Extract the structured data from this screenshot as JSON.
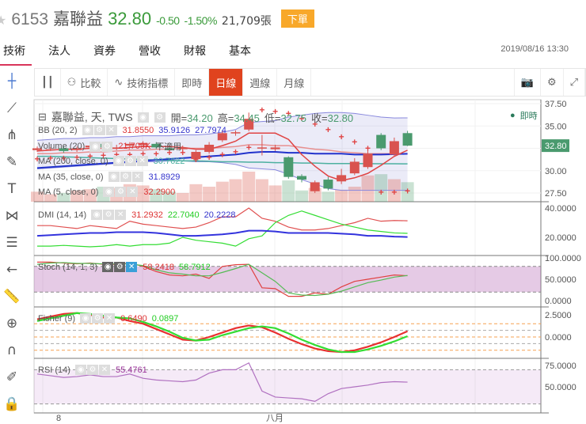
{
  "header": {
    "code": "6153",
    "name": "嘉聯益",
    "price": "32.80",
    "change": "-0.50",
    "change_pct": "-1.50%",
    "volume": "21,709張",
    "order_button": "下單"
  },
  "tabs": [
    {
      "label": "技術"
    },
    {
      "label": "法人"
    },
    {
      "label": "資券"
    },
    {
      "label": "營收"
    },
    {
      "label": "財報"
    },
    {
      "label": "基本"
    }
  ],
  "timestamp": "2019/08/16 13:30",
  "toolbar": {
    "compare": "比較",
    "indicators": "技術指標",
    "intraday": "即時",
    "daily": "日線",
    "weekly": "週線",
    "monthly": "月線"
  },
  "legend": {
    "title": "嘉聯益, 天, TWS",
    "open_label": "開=",
    "open": "34.20",
    "high_label": "高=",
    "high": "34.45",
    "low_label": "低=",
    "low": "32.75",
    "close_label": "收=",
    "close": "32.80",
    "bb": "BB (20, 2)",
    "bb_v": [
      "31.8550",
      "35.9126",
      "27.7974"
    ],
    "volume": "Volume (20)",
    "volume_v": [
      "21,709K",
      "不適用"
    ],
    "ma200": "MA (200, close, 0)",
    "ma200_v": "30.7622",
    "ma35": "MA (35, close, 0)",
    "ma35_v": "31.8929",
    "ma5": "MA (5, close, 0)",
    "ma5_v": "32.2900",
    "dmi": "DMI (14, 14)",
    "dmi_v": [
      "31.2932",
      "22.7040",
      "20.2228"
    ],
    "stoch": "Stoch (14, 1, 3)",
    "stoch_v": [
      "58.2418",
      "58.7912"
    ],
    "fisher": "Fisher (9)",
    "fisher_v": [
      "0.6490",
      "0.0897"
    ],
    "rsi": "RSI (14)",
    "rsi_v": "55.4761",
    "live": "即時"
  },
  "axis": {
    "price_ticks": [
      "37.50",
      "35.00",
      "30.00",
      "27.50"
    ],
    "last_price": "32.80",
    "dmi_ticks": [
      "40.0000",
      "20.0000"
    ],
    "stoch_ticks": [
      "100.0000",
      "50.0000",
      "0.0000"
    ],
    "fisher_ticks": [
      "2.5000",
      "0.0000"
    ],
    "rsi_ticks": [
      "75.0000",
      "50.0000"
    ],
    "x_ticks": [
      "8",
      "八月"
    ]
  },
  "colors": {
    "up": "#d9534f",
    "down": "#4a9a6e",
    "accent": "#e0431e"
  },
  "chart_data": {
    "type": "candlestick",
    "open": [
      32.3,
      32.4,
      32.5,
      32.3,
      32.6,
      33.0,
      32.5,
      32.8,
      32.9,
      33.0,
      32.5,
      32.4,
      31.3,
      32.1,
      33.4,
      34.2,
      34.6,
      32.5,
      32.4,
      31.5,
      29.4,
      27.7,
      29.0,
      28.8,
      29.7,
      30.4,
      34.0,
      31.8,
      34.2
    ],
    "close": [
      32.5,
      32.4,
      32.2,
      32.5,
      32.8,
      32.6,
      32.6,
      33.0,
      33.1,
      32.6,
      32.3,
      32.6,
      32.1,
      32.9,
      34.2,
      34.3,
      35.8,
      32.6,
      32.6,
      29.3,
      29.0,
      28.7,
      28.0,
      29.5,
      31.0,
      31.9,
      32.5,
      33.3,
      32.8
    ],
    "high": [
      32.7,
      32.6,
      32.7,
      32.7,
      33.0,
      33.2,
      32.9,
      33.2,
      33.3,
      33.2,
      32.7,
      32.8,
      32.3,
      33.2,
      34.5,
      34.5,
      36.5,
      34.0,
      32.9,
      31.6,
      29.6,
      28.9,
      29.3,
      30.2,
      31.4,
      32.3,
      34.2,
      33.7,
      34.45
    ],
    "low": [
      32.1,
      32.2,
      32.0,
      32.1,
      32.4,
      32.4,
      32.3,
      32.6,
      32.7,
      32.4,
      32.0,
      32.2,
      31.1,
      31.9,
      33.2,
      33.9,
      34.4,
      31.7,
      32.2,
      29.1,
      28.7,
      27.5,
      27.8,
      28.5,
      29.5,
      30.2,
      32.3,
      31.6,
      32.75
    ],
    "volume": [
      4000,
      3000,
      3500,
      4500,
      5000,
      6000,
      5500,
      7000,
      6500,
      5000,
      4000,
      3500,
      7000,
      6000,
      8000,
      9000,
      12000,
      9000,
      6500,
      8500,
      4500,
      5500,
      4000,
      4800,
      6000,
      10500,
      11000,
      9000,
      7800
    ],
    "bb_upper": [
      33.4,
      33.5,
      33.6,
      33.6,
      33.7,
      33.7,
      33.8,
      33.8,
      33.9,
      33.9,
      33.9,
      34.0,
      34.0,
      34.1,
      34.3,
      34.6,
      35.4,
      35.5,
      35.6,
      36.0,
      36.2,
      36.4,
      36.5,
      36.5,
      36.4,
      36.2,
      36.0,
      35.9,
      35.91
    ],
    "bb_mid": [
      31.9,
      31.9,
      32.0,
      32.0,
      32.1,
      32.1,
      32.2,
      32.3,
      32.3,
      32.4,
      32.4,
      32.5,
      32.5,
      32.5,
      32.6,
      32.7,
      32.9,
      32.9,
      32.8,
      32.8,
      32.6,
      32.4,
      32.3,
      32.1,
      32.0,
      31.9,
      31.9,
      31.9,
      31.86
    ],
    "bb_lower": [
      30.2,
      30.3,
      30.4,
      30.5,
      30.6,
      30.7,
      30.8,
      30.9,
      31.0,
      31.0,
      31.1,
      31.1,
      31.0,
      31.0,
      30.9,
      30.7,
      30.3,
      30.2,
      30.1,
      29.6,
      29.0,
      28.5,
      28.0,
      27.8,
      27.8,
      27.8,
      27.8,
      27.8,
      27.8
    ],
    "ma5": [
      32.2,
      32.3,
      32.4,
      32.4,
      32.5,
      32.5,
      32.5,
      32.6,
      32.7,
      32.7,
      32.7,
      32.6,
      32.4,
      32.4,
      32.8,
      33.3,
      34.2,
      34.2,
      34.2,
      33.5,
      31.8,
      30.5,
      29.4,
      28.9,
      29.2,
      29.7,
      30.6,
      31.6,
      32.29
    ],
    "ma35": [
      30.3,
      30.4,
      30.5,
      30.6,
      30.7,
      30.8,
      30.9,
      31.0,
      31.1,
      31.2,
      31.3,
      31.4,
      31.5,
      31.6,
      31.7,
      31.8,
      32.0,
      32.1,
      32.1,
      32.0,
      32.0,
      31.9,
      31.9,
      31.9,
      31.8,
      31.8,
      31.8,
      31.85,
      31.89
    ],
    "ma200": [
      31.6,
      31.6,
      31.55,
      31.5,
      31.45,
      31.4,
      31.35,
      31.3,
      31.25,
      31.2,
      31.15,
      31.1,
      31.1,
      31.05,
      31.0,
      31.0,
      30.95,
      30.95,
      30.9,
      30.9,
      30.85,
      30.85,
      30.8,
      30.8,
      30.8,
      30.78,
      30.77,
      30.77,
      30.76
    ],
    "sar": [
      31.3,
      31.4,
      31.4,
      31.5,
      31.6,
      31.7,
      31.8,
      31.8,
      31.9,
      31.9,
      32.0,
      32.0,
      31.2,
      31.5,
      31.8,
      32.1,
      32.6,
      36.8,
      36.6,
      36.4,
      35.8,
      35.2,
      34.6,
      33.8,
      33.2,
      32.5,
      27.6,
      27.6,
      27.7
    ],
    "dmi_plus": [
      28,
      28,
      27,
      26,
      28,
      27,
      26,
      31,
      29,
      28,
      27,
      26,
      27,
      30,
      34,
      34,
      40,
      33,
      31,
      27,
      25,
      25,
      26,
      28,
      30,
      33,
      31,
      31.5,
      31.29
    ],
    "dmi_minus": [
      14,
      14,
      14.5,
      14,
      13.5,
      14,
      15,
      14,
      15,
      15,
      16,
      20,
      18,
      17,
      16,
      14,
      19,
      21,
      30,
      35,
      38,
      35,
      32,
      29,
      27,
      25,
      24,
      23,
      22.7
    ],
    "adx": [
      21,
      21.5,
      22,
      22.5,
      23,
      23,
      23.5,
      23.5,
      23.5,
      23,
      22,
      21,
      21,
      21.5,
      22,
      23,
      24.5,
      24.5,
      24,
      23,
      23,
      23,
      23,
      22.5,
      22,
      21,
      21,
      20.5,
      20.22
    ],
    "stoch_k": [
      90,
      90,
      88,
      86,
      88,
      85,
      85,
      88,
      80,
      68,
      60,
      58,
      62,
      52,
      80,
      84,
      85,
      30,
      28,
      10,
      10,
      18,
      15,
      32,
      45,
      50,
      55,
      60,
      58.24
    ],
    "stoch_d": [
      85,
      88,
      89,
      87,
      87,
      86,
      86,
      86,
      82,
      72,
      65,
      62,
      58,
      58,
      66,
      75,
      85,
      65,
      45,
      18,
      13,
      12,
      15,
      22,
      32,
      42,
      48,
      55,
      58.79
    ],
    "fisher": [
      2.0,
      2.3,
      2.6,
      2.7,
      2.5,
      2.2,
      2.2,
      1.8,
      1.5,
      0.9,
      0.3,
      -0.3,
      -0.4,
      0.0,
      0.5,
      1.0,
      1.3,
      1.1,
      0.5,
      -0.2,
      -0.8,
      -1.3,
      -1.6,
      -1.7,
      -1.5,
      -1.1,
      -0.6,
      0.0,
      0.65
    ],
    "fisher_trigger": [
      1.8,
      2.1,
      2.4,
      2.7,
      2.6,
      2.4,
      2.2,
      2.1,
      1.7,
      1.2,
      0.6,
      -0.1,
      -0.4,
      -0.3,
      0.2,
      0.6,
      1.0,
      1.2,
      1.0,
      0.4,
      -0.3,
      -0.9,
      -1.4,
      -1.7,
      -1.7,
      -1.4,
      -1.0,
      -0.5,
      0.09
    ],
    "rsi": [
      65,
      63,
      61,
      62,
      64,
      62,
      62,
      65,
      60,
      58,
      57,
      56,
      58,
      66,
      70,
      70,
      78,
      45,
      38,
      37,
      36,
      33,
      42,
      48,
      50,
      52,
      55,
      56,
      55.48
    ]
  }
}
